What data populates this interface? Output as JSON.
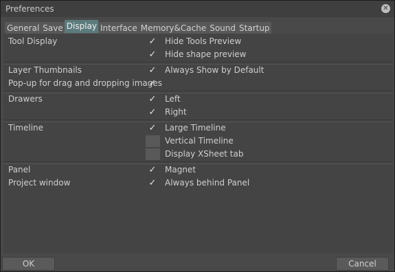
{
  "window": {
    "title": "Preferences"
  },
  "tabs": [
    {
      "label": "General"
    },
    {
      "label": "Save"
    },
    {
      "label": "Display"
    },
    {
      "label": "Interface"
    },
    {
      "label": "Memory&Cache"
    },
    {
      "label": "Sound"
    },
    {
      "label": "Startup"
    }
  ],
  "sections": {
    "tool_display": {
      "label": "Tool Display",
      "options": [
        {
          "label": "Hide Tools Preview",
          "checked": true
        },
        {
          "label": "Hide shape preview",
          "checked": true
        }
      ]
    },
    "layer_thumbnails": {
      "label": "Layer Thumbnails",
      "option": {
        "label": "Always Show by Default",
        "checked": true
      },
      "popup_label": "Pop-up for drag and dropping images",
      "popup_checked": true
    },
    "drawers": {
      "label": "Drawers",
      "options": [
        {
          "label": "Left",
          "checked": true
        },
        {
          "label": "Right",
          "checked": true
        }
      ]
    },
    "timeline": {
      "label": "Timeline",
      "options": [
        {
          "label": "Large Timeline",
          "checked": true
        },
        {
          "label": "Vertical Timeline",
          "checked": false
        },
        {
          "label": "Display XSheet tab",
          "checked": false
        }
      ]
    },
    "panel": {
      "label": "Panel",
      "option": {
        "label": "Magnet",
        "checked": true
      }
    },
    "project_window": {
      "label": "Project window",
      "option": {
        "label": "Always behind Panel",
        "checked": true
      }
    }
  },
  "icons": {
    "check": "✓",
    "close": "✕"
  },
  "buttons": {
    "ok": "OK",
    "cancel": "Cancel"
  }
}
